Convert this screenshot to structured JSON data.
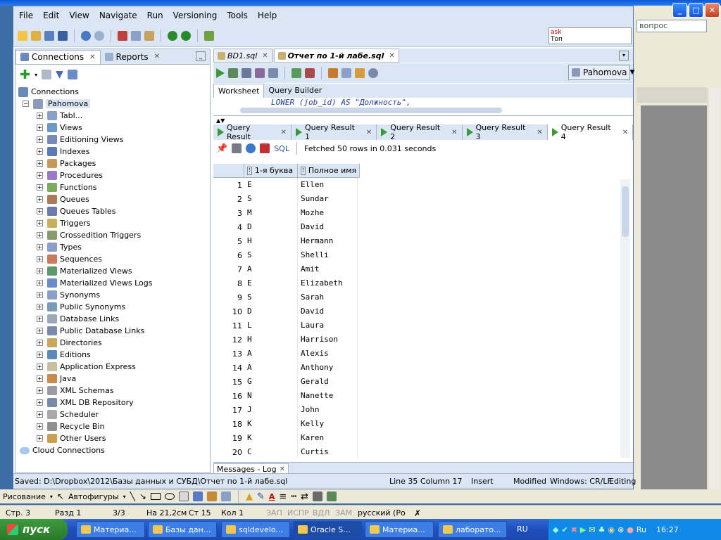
{
  "menu": [
    "File",
    "Edit",
    "View",
    "Navigate",
    "Run",
    "Versioning",
    "Tools",
    "Help"
  ],
  "ask_box": {
    "line1": "ask",
    "line2": "Топ"
  },
  "word": {
    "ask_placeholder": "вопрос"
  },
  "left_panel": {
    "tabs": [
      {
        "label": "Connections"
      },
      {
        "label": "Reports"
      }
    ],
    "root": "Connections",
    "connection": "Pahomova",
    "items": [
      "Tabl...",
      "Views",
      "Editioning Views",
      "Indexes",
      "Packages",
      "Procedures",
      "Functions",
      "Queues",
      "Queues Tables",
      "Triggers",
      "Crossedition Triggers",
      "Types",
      "Sequences",
      "Materialized Views",
      "Materialized Views Logs",
      "Synonyms",
      "Public Synonyms",
      "Database Links",
      "Public Database Links",
      "Directories",
      "Editions",
      "Application Express",
      "Java",
      "XML Schemas",
      "XML DB Repository",
      "Scheduler",
      "Recycle Bin",
      "Other Users"
    ],
    "cloud": "Cloud Connections"
  },
  "editor": {
    "tabs": [
      {
        "label": "BD1.sql"
      },
      {
        "label": "Отчет по 1-й лабе.sql"
      }
    ],
    "connection": "Pahomova",
    "worksheet_tabs": [
      "Worksheet",
      "Query Builder"
    ],
    "code": "LOWER (job_id) AS \"Должность\","
  },
  "results": {
    "tabs": [
      "Query Result",
      "Query Result 1",
      "Query Result 2",
      "Query Result 3",
      "Query Result 4"
    ],
    "sql_label": "SQL",
    "fetch_msg": "Fetched 50 rows in 0.031 seconds",
    "columns": [
      "1-я буква",
      "Полное имя"
    ],
    "rows": [
      [
        "1",
        "E",
        "Ellen"
      ],
      [
        "2",
        "S",
        "Sundar"
      ],
      [
        "3",
        "M",
        "Mozhe"
      ],
      [
        "4",
        "D",
        "David"
      ],
      [
        "5",
        "H",
        "Hermann"
      ],
      [
        "6",
        "S",
        "Shelli"
      ],
      [
        "7",
        "A",
        "Amit"
      ],
      [
        "8",
        "E",
        "Elizabeth"
      ],
      [
        "9",
        "S",
        "Sarah"
      ],
      [
        "10",
        "D",
        "David"
      ],
      [
        "11",
        "L",
        "Laura"
      ],
      [
        "12",
        "H",
        "Harrison"
      ],
      [
        "13",
        "A",
        "Alexis"
      ],
      [
        "14",
        "A",
        "Anthony"
      ],
      [
        "15",
        "G",
        "Gerald"
      ],
      [
        "16",
        "N",
        "Nanette"
      ],
      [
        "17",
        "J",
        "John"
      ],
      [
        "18",
        "K",
        "Kelly"
      ],
      [
        "19",
        "K",
        "Karen"
      ],
      [
        "20",
        "C",
        "Curtis"
      ]
    ]
  },
  "messages_tab": "Messages - Log",
  "status": {
    "saved": "Saved: D:\\Dropbox\\2012\\Базы данных и СУБД\\Отчет по 1-й лабе.sql",
    "position": "Line 35 Column 17",
    "mode": "Insert",
    "modified": "Modified",
    "eol": "Windows: CR/LF",
    "editing": "Editing"
  },
  "drawbar": {
    "draw": "Рисование",
    "autoshapes": "Автофигуры"
  },
  "word_status": {
    "page": "Стр. 3",
    "section": "Разд 1",
    "pages": "3/3",
    "at": "На 21,2см",
    "line": "Ст 15",
    "col": "Кол 1",
    "rec": "ЗАП",
    "trk": "ИСПР",
    "ext": "ВДЛ",
    "ovr": "ЗАМ",
    "lang": "русский (Ро"
  },
  "taskbar": {
    "start": "пуск",
    "items": [
      "Материа...",
      "Базы дан...",
      "sqldevelo...",
      "Oracle S...",
      "Материа...",
      "лаборато..."
    ],
    "lang": "RU",
    "tray_lang": "Ru",
    "time": "16:27"
  }
}
